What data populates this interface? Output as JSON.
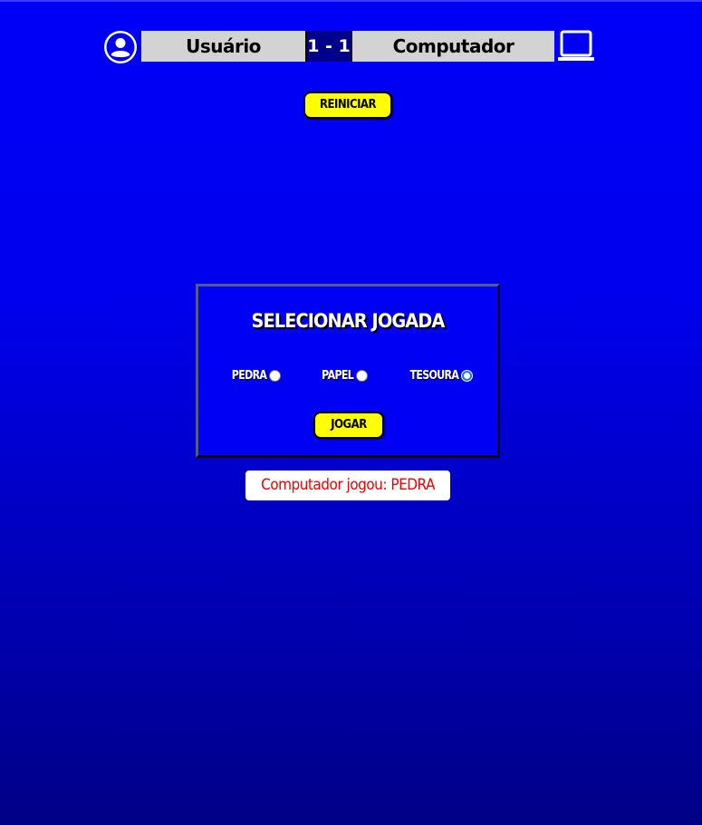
{
  "scoreboard": {
    "user_label": "Usuário",
    "score": "1 - 1",
    "computer_label": "Computador",
    "user_icon": "user-circle-icon",
    "computer_icon": "laptop-icon"
  },
  "controls": {
    "restart_label": "REINICIAR"
  },
  "panel": {
    "title": "SELECIONAR JOGADA",
    "options": [
      {
        "label": "PEDRA",
        "checked": false
      },
      {
        "label": "PAPEL",
        "checked": false
      },
      {
        "label": "TESOURA",
        "checked": true
      }
    ],
    "play_label": "JOGAR"
  },
  "result": {
    "text": "Computador jogou: PEDRA"
  },
  "colors": {
    "background_top": "#0000f8",
    "background_bottom": "#000085",
    "button_yellow": "#ffff00",
    "score_bg": "#00008b",
    "player_bg": "#d3d3d3",
    "result_text": "#ee0000"
  }
}
